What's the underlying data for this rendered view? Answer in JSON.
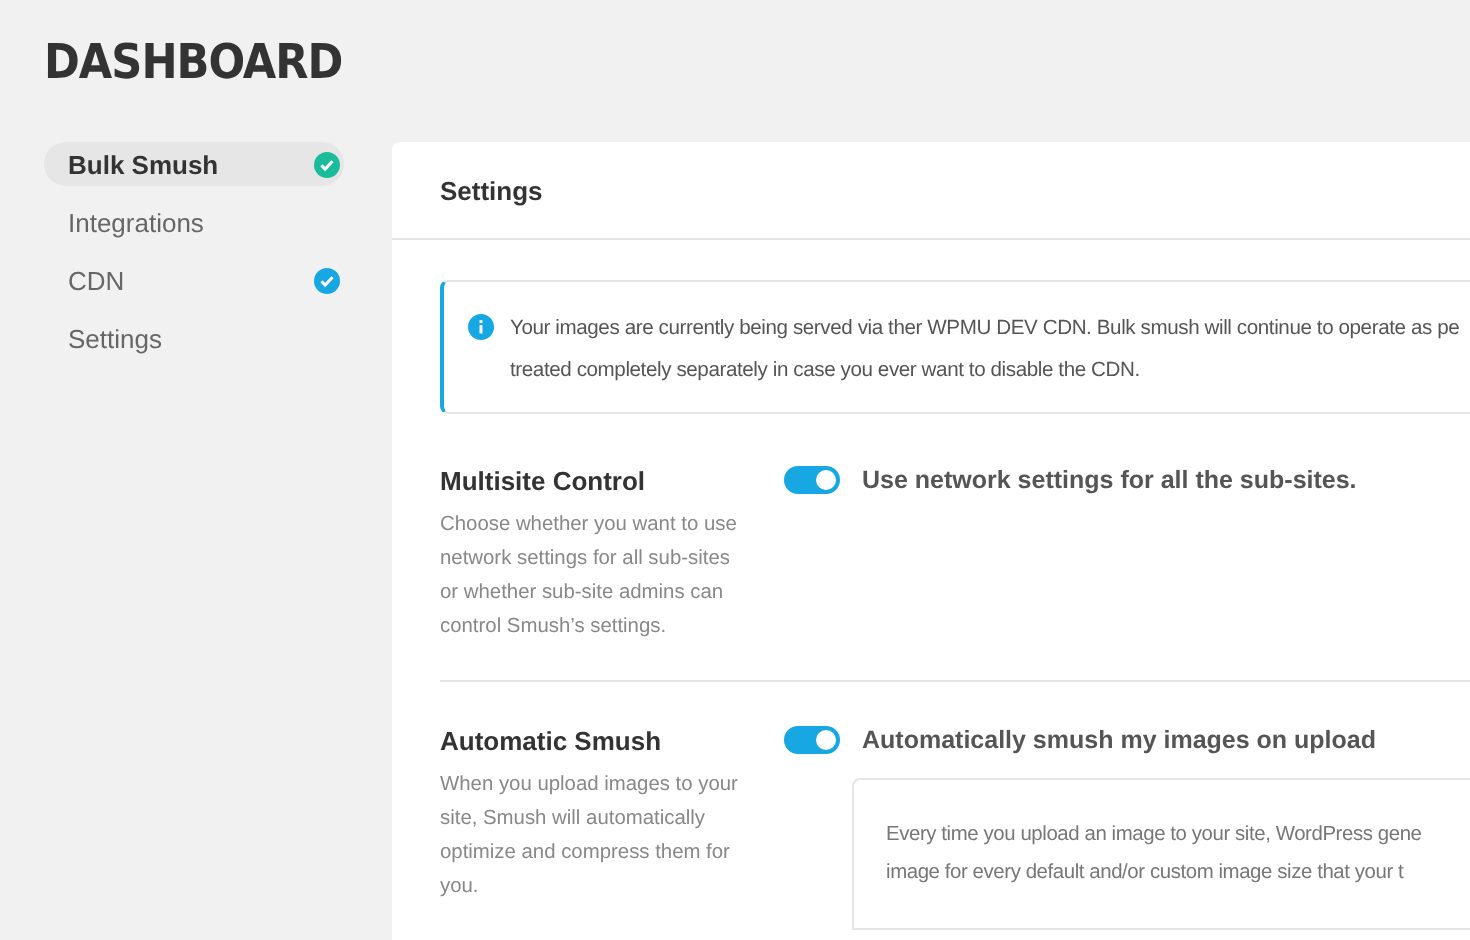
{
  "page_title": "DASHBOARD",
  "sidebar": {
    "items": [
      {
        "label": "Bulk Smush",
        "selected": true,
        "checked": true,
        "color": "#1abc9c"
      },
      {
        "label": "Integrations",
        "selected": false,
        "checked": false
      },
      {
        "label": "CDN",
        "selected": false,
        "checked": true,
        "color": "#17a8e3"
      },
      {
        "label": "Settings",
        "selected": false,
        "checked": false
      }
    ]
  },
  "panel": {
    "title": "Settings",
    "notice": {
      "lines": [
        "Your images are currently being served via ther WPMU DEV CDN. Bulk smush will continue to operate as pe",
        "treated completely separately in case you ever want to disable the CDN."
      ]
    },
    "settings": [
      {
        "title": "Multisite Control",
        "description": "Choose whether you want to use network settings for all sub-sites or whether sub-site admins can control Smush’s settings.",
        "toggle": {
          "label": "Use network settings for all the sub-sites.",
          "on": true
        }
      },
      {
        "title": "Automatic Smush",
        "description": "When you upload images to your site, Smush will automatically optimize and compress them for you.",
        "toggle": {
          "label": "Automatically smush my images on upload",
          "on": true
        },
        "detail_lines": [
          "Every time you upload an image to your site, WordPress gene",
          "image for every default and/or custom image size that your t"
        ]
      }
    ]
  }
}
